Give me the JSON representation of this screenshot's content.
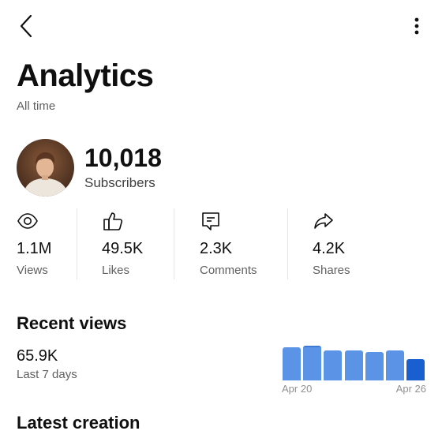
{
  "header": {
    "back_icon": "chevron-left-icon",
    "more_icon": "more-vertical-icon"
  },
  "title": "Analytics",
  "subtitle": "All time",
  "channel": {
    "subscribers": "10,018",
    "subscribers_label": "Subscribers"
  },
  "stats": [
    {
      "icon": "eye-icon",
      "value": "1.1M",
      "label": "Views"
    },
    {
      "icon": "thumbs-up-icon",
      "value": "49.5K",
      "label": "Likes"
    },
    {
      "icon": "comment-icon",
      "value": "2.3K",
      "label": "Comments"
    },
    {
      "icon": "share-icon",
      "value": "4.2K",
      "label": "Shares"
    }
  ],
  "recent_views": {
    "title": "Recent views",
    "value": "65.9K",
    "period": "Last 7 days",
    "chart": {
      "bar_levels": [
        0.88,
        0.91,
        0.79,
        0.79,
        0.76,
        0.79,
        0.56
      ],
      "highlight_index": 6,
      "start_label": "Apr 20",
      "end_label": "Apr 26",
      "colors": {
        "bar": "#5b94e6",
        "bar_outline": "#3d7ad6",
        "highlight": "#1a5fd0"
      }
    }
  },
  "latest_creation": {
    "title": "Latest creation"
  }
}
